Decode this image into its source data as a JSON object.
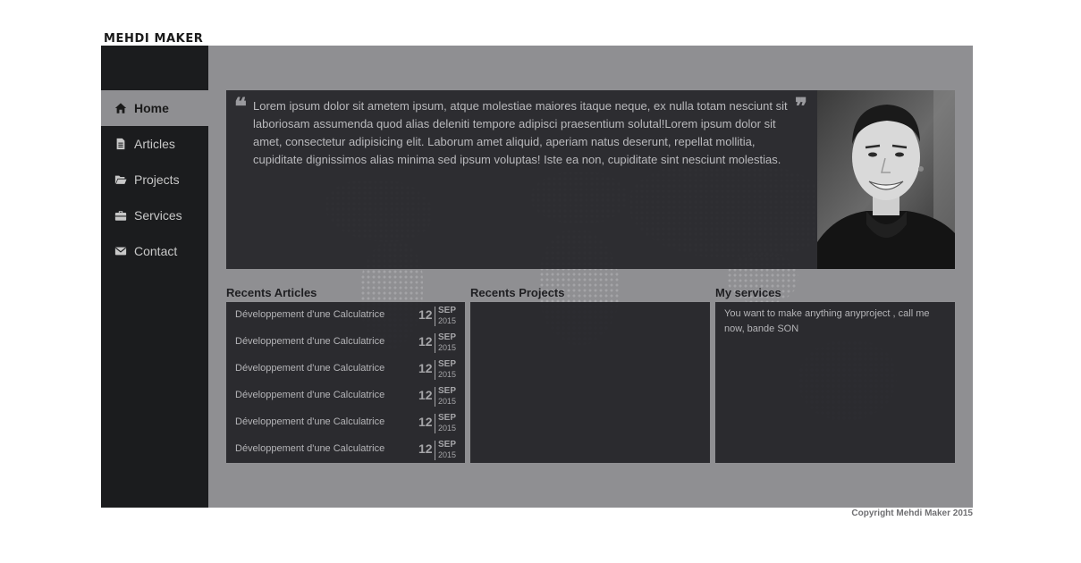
{
  "brand": {
    "title": "MEHDI MAKER"
  },
  "nav": {
    "items": [
      {
        "label": "Home",
        "icon": "home-icon",
        "active": true
      },
      {
        "label": "Articles",
        "icon": "document-icon",
        "active": false
      },
      {
        "label": "Projects",
        "icon": "folder-open-icon",
        "active": false
      },
      {
        "label": "Services",
        "icon": "briefcase-icon",
        "active": false
      },
      {
        "label": "Contact",
        "icon": "envelope-icon",
        "active": false
      }
    ]
  },
  "quote": {
    "text": "Lorem ipsum dolor sit ametem ipsum, atque molestiae maiores itaque neque, ex nulla totam nesciunt sit laboriosam assumenda quod alias deleniti tempore adipisci praesentium solutal!Lorem ipsum dolor sit amet, consectetur adipisicing elit. Laborum amet aliquid, aperiam natus deserunt, repellat mollitia, cupiditate dignissimos alias minima sed ipsum voluptas! Iste ea non, cupiditate sint nesciunt molestias."
  },
  "sections": {
    "articles_title": "Recents Articles",
    "projects_title": "Recents Projects",
    "services_title": "My services"
  },
  "articles": [
    {
      "title": "Développement d'une Calculatrice",
      "day": "12",
      "month": "SEP",
      "year": "2015"
    },
    {
      "title": "Développement d'une Calculatrice",
      "day": "12",
      "month": "SEP",
      "year": "2015"
    },
    {
      "title": "Développement d'une Calculatrice",
      "day": "12",
      "month": "SEP",
      "year": "2015"
    },
    {
      "title": "Développement d'une Calculatrice",
      "day": "12",
      "month": "SEP",
      "year": "2015"
    },
    {
      "title": "Développement d'une Calculatrice",
      "day": "12",
      "month": "SEP",
      "year": "2015"
    },
    {
      "title": "Développement d'une Calculatrice",
      "day": "12",
      "month": "SEP",
      "year": "2015"
    }
  ],
  "services": {
    "text": "You want to make anything anyproject , call me now, bande SON"
  },
  "footer": {
    "copyright": "Copyright Mehdi Maker 2015"
  },
  "colors": {
    "sidebar": "#1b1c1e",
    "frame": "#8f8f92",
    "panel": "#26262a",
    "text_light": "#b5b5b8"
  }
}
